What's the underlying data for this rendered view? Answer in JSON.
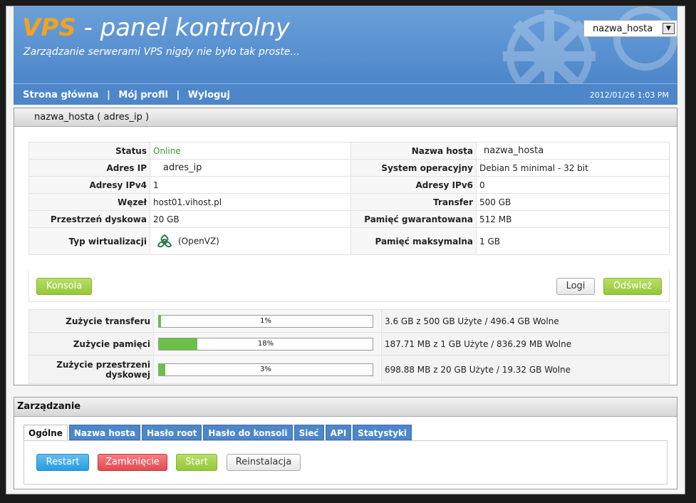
{
  "header": {
    "brand": "VPS",
    "title_rest": " - panel kontrolny",
    "tagline": "Zarządzanie serwerami VPS nigdy nie było tak proste...",
    "host_select": "nazwa_hosta"
  },
  "nav": {
    "items": [
      "Strona główna",
      "Mój profil",
      "Wyloguj"
    ],
    "separator": "|",
    "datetime": "2012/01/26 1:03 PM"
  },
  "host_panel": {
    "title": "nazwa_hosta ( adres_ip )",
    "left": [
      {
        "label": "Status",
        "value": "Online"
      },
      {
        "label": "Adres IP",
        "value": "adres_ip"
      },
      {
        "label": "Adresy IPv4",
        "value": "1"
      },
      {
        "label": "Węzeł",
        "value": "host01.vihost.pl"
      },
      {
        "label": "Przestrzeń dyskowa",
        "value": "20 GB"
      },
      {
        "label": "Typ wirtualizacji",
        "value": "(OpenVZ)"
      }
    ],
    "right": [
      {
        "label": "Nazwa hosta",
        "value": "nazwa_hosta"
      },
      {
        "label": "System operacyjny",
        "value": "Debian 5 minimal - 32 bit"
      },
      {
        "label": "Adresy IPv6",
        "value": "0"
      },
      {
        "label": "Transfer",
        "value": "500 GB"
      },
      {
        "label": "Pamięć gwarantowana",
        "value": "512 MB"
      },
      {
        "label": "Pamięć maksymalna",
        "value": "1 GB"
      }
    ],
    "buttons": {
      "console": "Konsola",
      "login": "Logi",
      "refresh": "Odśwież"
    },
    "usage": [
      {
        "label": "Zużycie transferu",
        "percent": 1,
        "percent_label": "1%",
        "text": "3.6 GB z 500 GB Użyte / 496.4 GB Wolne"
      },
      {
        "label": "Zużycie pamięci",
        "percent": 18,
        "percent_label": "18%",
        "text": "187.71 MB z 1 GB Użyte / 836.29 MB Wolne"
      },
      {
        "label": "Zużycie przestrzeni dyskowej",
        "percent": 3,
        "percent_label": "3%",
        "text": "698.88 MB z 20 GB Użyte / 19.32 GB Wolne"
      }
    ]
  },
  "management": {
    "title": "Zarządzanie",
    "tabs": [
      "Ogólne",
      "Nazwa hosta",
      "Hasło root",
      "Hasło do konsoli",
      "Sieć",
      "API",
      "Statystyki"
    ],
    "active_tab": "Ogólne",
    "actions": {
      "restart": "Restart",
      "shutdown": "Zamknięcie",
      "start": "Start",
      "reinstall": "Reinstalacja"
    }
  },
  "colors": {
    "brand": "#f3a320",
    "header_blue": "#4d86c9",
    "online": "#2f9a2f",
    "bar_fill": "#6cc04a"
  }
}
